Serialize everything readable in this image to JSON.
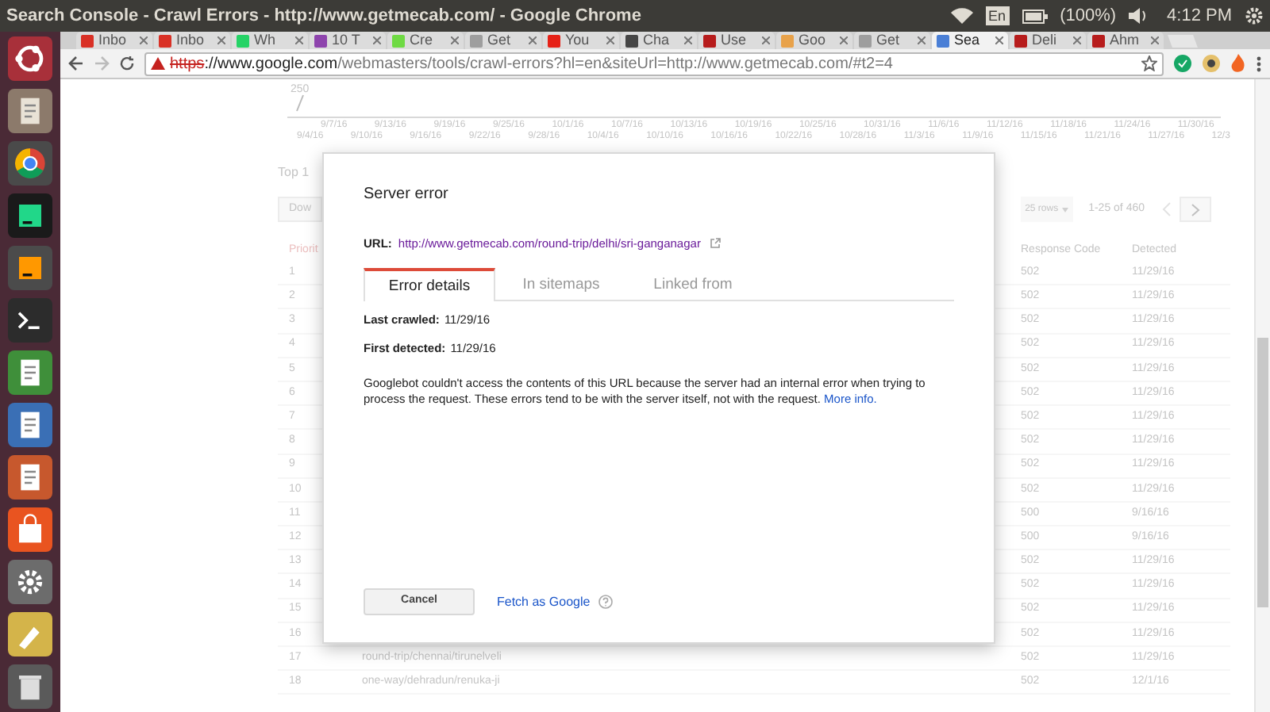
{
  "top_panel": {
    "title": "Search Console - Crawl Errors - http://www.getmecab.com/ - Google Chrome",
    "keyboard": "En",
    "battery": "(100%)",
    "clock": "4:12 PM"
  },
  "launcher": [
    {
      "kind": "dash"
    },
    {
      "kind": "files"
    },
    {
      "kind": "chrome"
    },
    {
      "kind": "pycharm"
    },
    {
      "kind": "sublime"
    },
    {
      "kind": "terminal"
    },
    {
      "kind": "calc"
    },
    {
      "kind": "writer"
    },
    {
      "kind": "impress"
    },
    {
      "kind": "store"
    },
    {
      "kind": "settings"
    },
    {
      "kind": "paint"
    },
    {
      "kind": "trash"
    }
  ],
  "tabs": [
    {
      "label": "Inbo",
      "color": "#d93025",
      "selected": false
    },
    {
      "label": "Inbo",
      "color": "#d93025",
      "selected": false
    },
    {
      "label": "Wh",
      "color": "#25d366",
      "selected": false
    },
    {
      "label": "10 T",
      "color": "#8e44ad",
      "selected": false
    },
    {
      "label": "Cre",
      "color": "#6fda44",
      "selected": false
    },
    {
      "label": "Get",
      "color": "#9e9e9e",
      "selected": false
    },
    {
      "label": "You",
      "color": "#e62117",
      "selected": false
    },
    {
      "label": "Cha",
      "color": "#464646",
      "selected": false
    },
    {
      "label": "Use",
      "color": "#b71c1c",
      "selected": false
    },
    {
      "label": "Goo",
      "color": "#e8a24a",
      "selected": false
    },
    {
      "label": "Get",
      "color": "#9e9e9e",
      "selected": false
    },
    {
      "label": "Sea",
      "color": "#4a7fd6",
      "selected": true
    },
    {
      "label": "Deli",
      "color": "#b71c1c",
      "selected": false
    },
    {
      "label": "Ahm",
      "color": "#b71c1c",
      "selected": false
    }
  ],
  "address": {
    "scheme": "https",
    "host": "://www.google.com",
    "path": "/webmasters/tools/crawl-errors?hl=en&siteUrl=http://www.getmecab.com/#t2=4"
  },
  "chart": {
    "y_label": "250",
    "x_labels_top": [
      "9/7/16",
      "9/13/16",
      "9/19/16",
      "9/25/16",
      "10/1/16",
      "10/7/16",
      "10/13/16",
      "10/19/16",
      "10/25/16",
      "10/31/16",
      "11/6/16",
      "11/12/16",
      "11/18/16",
      "11/24/16",
      "11/30/16"
    ],
    "x_labels_bottom": [
      "9/4/16",
      "9/10/16",
      "9/16/16",
      "9/22/16",
      "9/28/16",
      "10/4/16",
      "10/10/16",
      "10/16/16",
      "10/22/16",
      "10/28/16",
      "11/3/16",
      "11/9/16",
      "11/15/16",
      "11/21/16",
      "11/27/16",
      "12/3"
    ]
  },
  "table": {
    "heading": "Top 1",
    "download": "Dow",
    "rows_select": "25 rows",
    "range": "1-25 of 460",
    "columns": [
      "Priorit",
      "Response Code",
      "Detected"
    ],
    "rows": [
      {
        "num": "1",
        "code": "502",
        "detected": "11/29/16"
      },
      {
        "num": "2",
        "code": "502",
        "detected": "11/29/16"
      },
      {
        "num": "3",
        "code": "502",
        "detected": "11/29/16"
      },
      {
        "num": "4",
        "code": "502",
        "detected": "11/29/16"
      },
      {
        "num": "5",
        "code": "502",
        "detected": "11/29/16"
      },
      {
        "num": "6",
        "code": "502",
        "detected": "11/29/16"
      },
      {
        "num": "7",
        "code": "502",
        "detected": "11/29/16"
      },
      {
        "num": "8",
        "code": "502",
        "detected": "11/29/16"
      },
      {
        "num": "9",
        "code": "502",
        "detected": "11/29/16"
      },
      {
        "num": "10",
        "code": "502",
        "detected": "11/29/16"
      },
      {
        "num": "11",
        "code": "500",
        "detected": "9/16/16"
      },
      {
        "num": "12",
        "code": "500",
        "detected": "9/16/16"
      },
      {
        "num": "13",
        "code": "502",
        "detected": "11/29/16"
      },
      {
        "num": "14",
        "code": "502",
        "detected": "11/29/16"
      },
      {
        "num": "15",
        "code": "502",
        "detected": "11/29/16"
      },
      {
        "num": "16",
        "code": "502",
        "detected": "11/29/16"
      },
      {
        "num": "17",
        "url": "round-trip/chennai/tirunelveli",
        "code": "502",
        "detected": "11/29/16"
      },
      {
        "num": "18",
        "url": "one-way/dehradun/renuka-ji",
        "code": "502",
        "detected": "12/1/16"
      }
    ]
  },
  "dialog": {
    "title": "Server error",
    "url_label": "URL:",
    "url": "http://www.getmecab.com/round-trip/delhi/sri-ganganagar",
    "tabs": [
      {
        "label": "Error details",
        "selected": true
      },
      {
        "label": "In sitemaps",
        "selected": false
      },
      {
        "label": "Linked from",
        "selected": false
      }
    ],
    "facts": [
      {
        "label": "Last crawled:",
        "value": "11/29/16"
      },
      {
        "label": "First detected:",
        "value": "11/29/16"
      }
    ],
    "message": "Googlebot couldn't access the contents of this URL because the server had an internal error when trying to process the request. These errors tend to be with the server itself, not with the request.",
    "more_link": "More info.",
    "cancel": "Cancel",
    "fetch_link": "Fetch as Google"
  }
}
